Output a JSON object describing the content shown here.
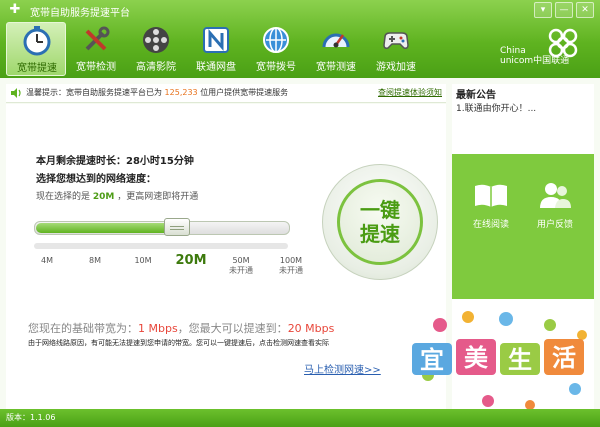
{
  "app": {
    "title": "宽带自助服务提速平台"
  },
  "window": {
    "minimize": "▾",
    "restore": "—",
    "close": "✕"
  },
  "nav": [
    {
      "label": "宽带提速",
      "icon": "stopwatch-icon",
      "active": true
    },
    {
      "label": "宽带检测",
      "icon": "tools-icon",
      "active": false
    },
    {
      "label": "高清影院",
      "icon": "film-reel-icon",
      "active": false
    },
    {
      "label": "联通网盘",
      "icon": "netdisk-n-icon",
      "active": false
    },
    {
      "label": "宽带拨号",
      "icon": "globe-dial-icon",
      "active": false
    },
    {
      "label": "宽带测速",
      "icon": "speedometer-icon",
      "active": false
    },
    {
      "label": "游戏加速",
      "icon": "gamepad-icon",
      "active": false
    }
  ],
  "brand": {
    "en_line1": "China",
    "en_line2": "unicom中国联通"
  },
  "notice": {
    "prefix": "温馨提示：宽带自助服务提速平台已为",
    "count": "125,233",
    "suffix": "位用户提供宽带提速服务",
    "link": "查阅提速体验须知"
  },
  "main": {
    "remaining": "本月剩余提速时长：28小时15分钟",
    "target_label": "选择您想达到的网络速度：",
    "selection_prefix": "现在选择的是",
    "selection_value": "20M",
    "selection_suffix": "，更高网速即将开通",
    "slider_fraction": 0.56,
    "ticks": [
      {
        "label": "4M",
        "sub": "",
        "current": false
      },
      {
        "label": "8M",
        "sub": "",
        "current": false
      },
      {
        "label": "10M",
        "sub": "",
        "current": false
      },
      {
        "label": "20M",
        "sub": "",
        "current": true
      },
      {
        "label": "50M",
        "sub": "未开通",
        "current": false
      },
      {
        "label": "100M",
        "sub": "未开通",
        "current": false
      }
    ],
    "boost_button": "一键提速",
    "basic_prefix": "您现在的基础带宽为：",
    "basic_value": "1 Mbps",
    "basic_mid": "，您最大可以提速到：",
    "max_value": "20 Mbps",
    "note": "由于网络线路原因，有可能无法提速到您申请的带宽。您可以一键提速后，点击检测网速查看实际",
    "detect_link": "马上检测网速>>"
  },
  "side": {
    "title": "最新公告",
    "announcement": "1.联通由你开心！...",
    "read_online": "在线阅读",
    "feedback": "用户反馈"
  },
  "decoration": {
    "text": "宜美生活"
  },
  "status": {
    "version": "版本：1.1.06"
  },
  "colors": {
    "brand_green": "#5fb320",
    "accent_orange": "#e8731e",
    "speed_red": "#e8463a"
  }
}
